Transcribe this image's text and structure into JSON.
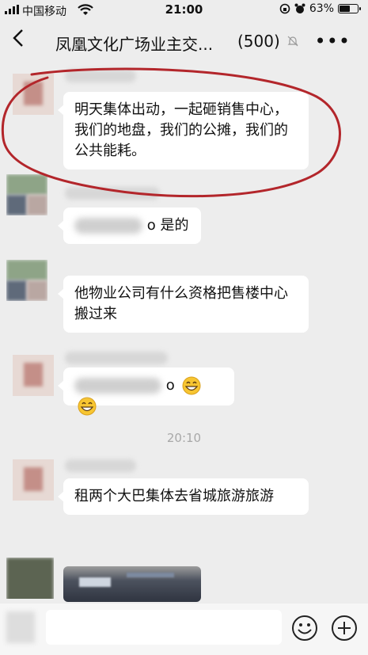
{
  "status_bar": {
    "carrier": "中国移动",
    "time": "21:00",
    "battery": "63%",
    "battery_level": 0.63
  },
  "header": {
    "title": "凤凰文化广场业主交...",
    "member_count": "(500)"
  },
  "messages": [
    {
      "text": "明天集体出动，一起砸销售中心，我们的地盘，我们的公摊，我们的公共能耗。"
    },
    {
      "text": "o 是的"
    },
    {
      "text": "他物业公司有什么资格把售楼中心搬过来"
    },
    {
      "text": "o"
    },
    {
      "text": "租两个大巴集体去省城旅游旅游"
    }
  ],
  "timestamp": "20:10",
  "icons": {
    "back": "back-chevron-icon",
    "mute": "bell-off-icon",
    "more": "more-icon",
    "emoji": "emoji-icon",
    "plus": "plus-icon",
    "grin": "grinning-face-icon"
  },
  "colors": {
    "background": "#ededed",
    "bubble": "#ffffff",
    "annotation": "#b3262b"
  }
}
